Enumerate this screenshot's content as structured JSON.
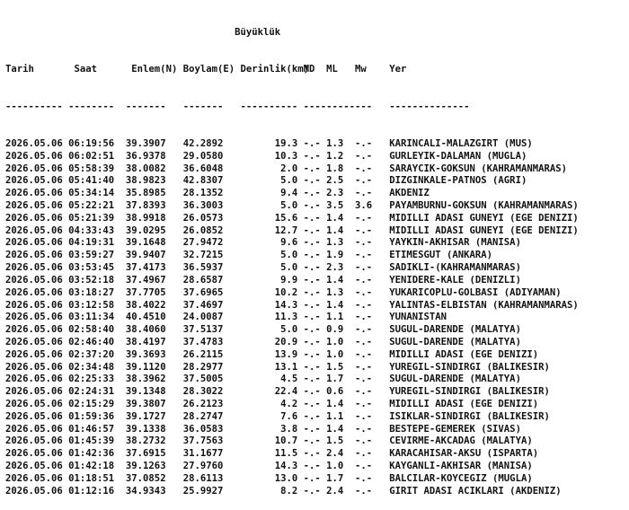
{
  "group_header": "Büyüklük",
  "columns": [
    "Tarih",
    "Saat",
    "Enlem(N)",
    "Boylam(E)",
    "Derinlik(km)",
    "MD",
    "ML",
    "Mw",
    "Yer"
  ],
  "separators": [
    "----------",
    "--------",
    "-------",
    "-------",
    "----------",
    "------------",
    "",
    "",
    "--------------"
  ],
  "rows": [
    [
      "2026.05.06",
      "06:19:56",
      "39.3907",
      "42.2892",
      "19.3",
      "-.-",
      "1.3",
      "-.-",
      "KARINCALI-MALAZGIRT (MUS)"
    ],
    [
      "2026.05.06",
      "06:02:51",
      "36.9378",
      "29.0580",
      "10.3",
      "-.-",
      "1.2",
      "-.-",
      "GURLEYIK-DALAMAN (MUGLA)"
    ],
    [
      "2026.05.06",
      "05:58:39",
      "38.0082",
      "36.6048",
      "2.0",
      "-.-",
      "1.8",
      "-.-",
      "SARAYCIK-GOKSUN (KAHRAMANMARAS)"
    ],
    [
      "2026.05.06",
      "05:41:40",
      "38.9823",
      "42.8307",
      "5.0",
      "-.-",
      "2.5",
      "-.-",
      "DIZGINKALE-PATNOS (AGRI)"
    ],
    [
      "2026.05.06",
      "05:34:14",
      "35.8985",
      "28.1352",
      "9.4",
      "-.-",
      "2.3",
      "-.-",
      "AKDENIZ"
    ],
    [
      "2026.05.06",
      "05:22:21",
      "37.8393",
      "36.3003",
      "5.0",
      "-.-",
      "3.5",
      "3.6",
      "PAYAMBURNU-GOKSUN (KAHRAMANMARAS)"
    ],
    [
      "2026.05.06",
      "05:21:39",
      "38.9918",
      "26.0573",
      "15.6",
      "-.-",
      "1.4",
      "-.-",
      "MIDILLI ADASI GUNEYI (EGE DENIZI)"
    ],
    [
      "2026.05.06",
      "04:33:43",
      "39.0295",
      "26.0852",
      "12.7",
      "-.-",
      "1.4",
      "-.-",
      "MIDILLI ADASI GUNEYI (EGE DENIZI)"
    ],
    [
      "2026.05.06",
      "04:19:31",
      "39.1648",
      "27.9472",
      "9.6",
      "-.-",
      "1.3",
      "-.-",
      "YAYKIN-AKHISAR (MANISA)"
    ],
    [
      "2026.05.06",
      "03:59:27",
      "39.9407",
      "32.7215",
      "5.0",
      "-.-",
      "1.9",
      "-.-",
      "ETIMESGUT (ANKARA)"
    ],
    [
      "2026.05.06",
      "03:53:45",
      "37.4173",
      "36.5937",
      "5.0",
      "-.-",
      "2.3",
      "-.-",
      "SADIKLI-(KAHRAMANMARAS)"
    ],
    [
      "2026.05.06",
      "03:52:18",
      "37.4967",
      "28.6587",
      "9.9",
      "-.-",
      "1.4",
      "-.-",
      "YENIDERE-KALE (DENIZLI)"
    ],
    [
      "2026.05.06",
      "03:18:27",
      "37.7705",
      "37.6965",
      "10.2",
      "-.-",
      "1.3",
      "-.-",
      "YUKARICOPLU-GOLBASI (ADIYAMAN)"
    ],
    [
      "2026.05.06",
      "03:12:58",
      "38.4022",
      "37.4697",
      "14.3",
      "-.-",
      "1.4",
      "-.-",
      "YALINTAS-ELBISTAN (KAHRAMANMARAS)"
    ],
    [
      "2026.05.06",
      "03:11:34",
      "40.4510",
      "24.0087",
      "11.3",
      "-.-",
      "1.1",
      "-.-",
      "YUNANISTAN"
    ],
    [
      "2026.05.06",
      "02:58:40",
      "38.4060",
      "37.5137",
      "5.0",
      "-.-",
      "0.9",
      "-.-",
      "SUGUL-DARENDE (MALATYA)"
    ],
    [
      "2026.05.06",
      "02:46:40",
      "38.4197",
      "37.4783",
      "20.9",
      "-.-",
      "1.0",
      "-.-",
      "SUGUL-DARENDE (MALATYA)"
    ],
    [
      "2026.05.06",
      "02:37:20",
      "39.3693",
      "26.2115",
      "13.9",
      "-.-",
      "1.0",
      "-.-",
      "MIDILLI ADASI (EGE DENIZI)"
    ],
    [
      "2026.05.06",
      "02:34:48",
      "39.1120",
      "28.2977",
      "13.1",
      "-.-",
      "1.5",
      "-.-",
      "YUREGIL-SINDIRGI (BALIKESIR)"
    ],
    [
      "2026.05.06",
      "02:25:33",
      "38.3962",
      "37.5005",
      "4.5",
      "-.-",
      "1.7",
      "-.-",
      "SUGUL-DARENDE (MALATYA)"
    ],
    [
      "2026.05.06",
      "02:24:31",
      "39.1348",
      "28.3022",
      "22.4",
      "-.-",
      "0.6",
      "-.-",
      "YUREGIL-SINDIRGI (BALIKESIR)"
    ],
    [
      "2026.05.06",
      "02:15:29",
      "39.3807",
      "26.2123",
      "4.2",
      "-.-",
      "1.4",
      "-.-",
      "MIDILLI ADASI (EGE DENIZI)"
    ],
    [
      "2026.05.06",
      "01:59:36",
      "39.1727",
      "28.2747",
      "7.6",
      "-.-",
      "1.1",
      "-.-",
      "ISIKLAR-SINDIRGI (BALIKESIR)"
    ],
    [
      "2026.05.06",
      "01:46:57",
      "39.1338",
      "36.0583",
      "3.8",
      "-.-",
      "1.4",
      "-.-",
      "BESTEPE-GEMEREK (SIVAS)"
    ],
    [
      "2026.05.06",
      "01:45:39",
      "38.2732",
      "37.7563",
      "10.7",
      "-.-",
      "1.5",
      "-.-",
      "CEVIRME-AKCADAG (MALATYA)"
    ],
    [
      "2026.05.06",
      "01:42:36",
      "37.6915",
      "31.1677",
      "11.5",
      "-.-",
      "2.4",
      "-.-",
      "KARACAHISAR-AKSU (ISPARTA)"
    ],
    [
      "2026.05.06",
      "01:42:18",
      "39.1263",
      "27.9760",
      "14.3",
      "-.-",
      "1.0",
      "-.-",
      "KAYGANLI-AKHISAR (MANISA)"
    ],
    [
      "2026.05.06",
      "01:18:51",
      "37.0852",
      "28.6113",
      "13.0",
      "-.-",
      "1.7",
      "-.-",
      "BALCILAR-KOYCEGIZ (MUGLA)"
    ],
    [
      "2026.05.06",
      "01:12:16",
      "34.9343",
      "25.9927",
      "8.2",
      "-.-",
      "2.4",
      "-.-",
      "GIRIT ADASI ACIKLARI (AKDENIZ)"
    ]
  ]
}
